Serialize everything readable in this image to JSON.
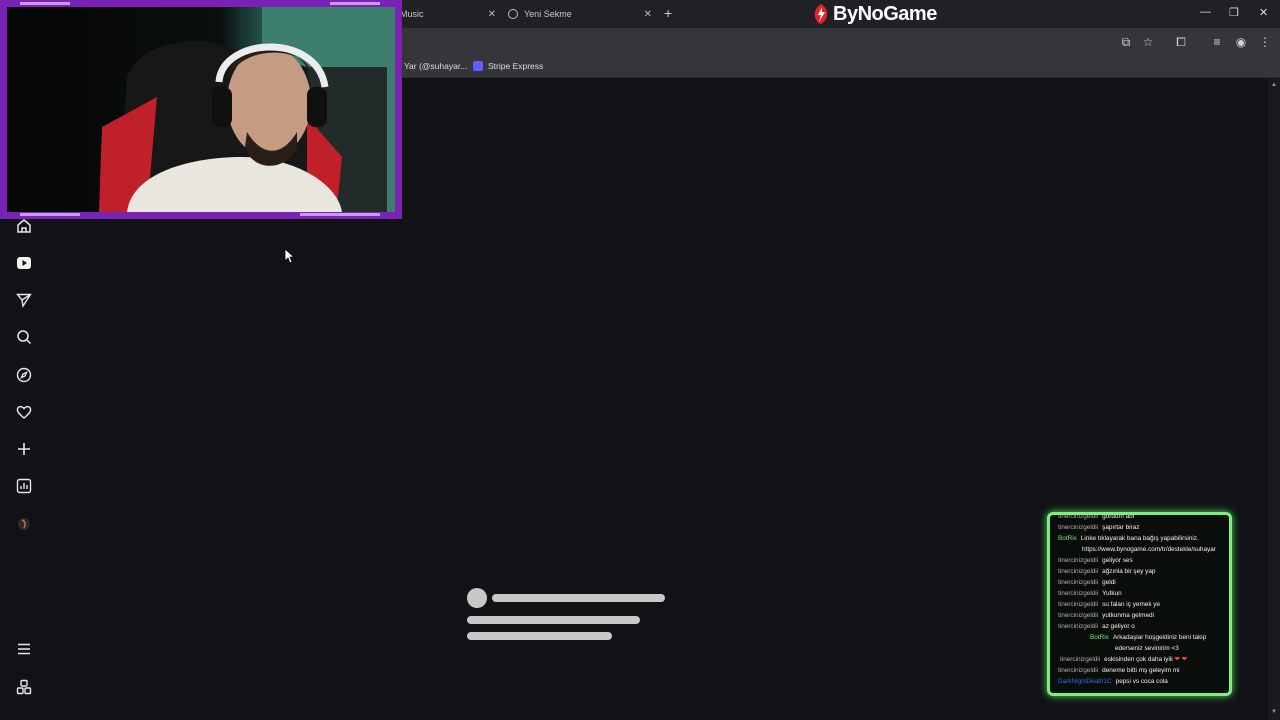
{
  "browser": {
    "tabs": [
      {
        "label": "Music"
      },
      {
        "label": "Yeni Sekme"
      }
    ],
    "new_tab_label": "+",
    "brand": "ByNoGame",
    "bookmarks": [
      {
        "label": "Yar (@suhayar..."
      },
      {
        "label": "Stripe Express"
      }
    ]
  },
  "sidebar": {
    "items": [
      {
        "icon": "home-icon"
      },
      {
        "icon": "video-icon"
      },
      {
        "icon": "send-icon"
      },
      {
        "icon": "search-icon"
      },
      {
        "icon": "compass-icon"
      },
      {
        "icon": "heart-icon"
      },
      {
        "icon": "plus-icon"
      },
      {
        "icon": "chart-icon"
      },
      {
        "icon": "avatar-icon"
      },
      {
        "icon": "menu-icon"
      },
      {
        "icon": "apps-icon"
      }
    ]
  },
  "chat": {
    "messages": [
      {
        "user": "tinercinizgeldii",
        "text": "gördüm abi",
        "type": "normal"
      },
      {
        "user": "tinercinizgeldii",
        "text": "şapırtar biraz",
        "type": "normal"
      },
      {
        "user": "BotRix",
        "text": "Linke tıklayarak bana bağış yapabilirsiniz.",
        "text2": "https://www.bynogame.com/tr/destekle/suhayar",
        "type": "bot"
      },
      {
        "user": "tinercinizgeldii",
        "text": "geliyor ses",
        "type": "normal"
      },
      {
        "user": "tinercinizgeldii",
        "text": "ağzınla bir şey yap",
        "type": "normal"
      },
      {
        "user": "tinercinizgeldii",
        "text": "geldi",
        "type": "normal"
      },
      {
        "user": "tinercinizgeldii",
        "text": "Yutkun",
        "type": "normal"
      },
      {
        "user": "tinercinizgeldii",
        "text": "su falan iç yemek ye",
        "type": "normal"
      },
      {
        "user": "tinercinizgeldii",
        "text": "yutkunma gelmedi",
        "type": "normal"
      },
      {
        "user": "tinercinizgeldii",
        "text": "az geliyor o",
        "type": "normal"
      },
      {
        "user": "BotRix",
        "text": "Arkadaşlar hoşgeldiniz beni takip",
        "text2": "ederseniz sevinirim <3",
        "type": "bot"
      },
      {
        "user": "tinercinizgeldii",
        "text": "eskisinden çok daha iyili",
        "type": "normal",
        "hearts": "❤ ❤"
      },
      {
        "user": "tinercinizgeldii",
        "text": "deneme bitti mş geleyim mi",
        "type": "normal"
      },
      {
        "user": "DarkNightDeath1C",
        "text": "pepsi vs coca cola",
        "type": "blue"
      }
    ]
  },
  "colors": {
    "cam_border": "#7a22b5",
    "chat_border": "#7cf07c",
    "page_bg": "#111216"
  }
}
